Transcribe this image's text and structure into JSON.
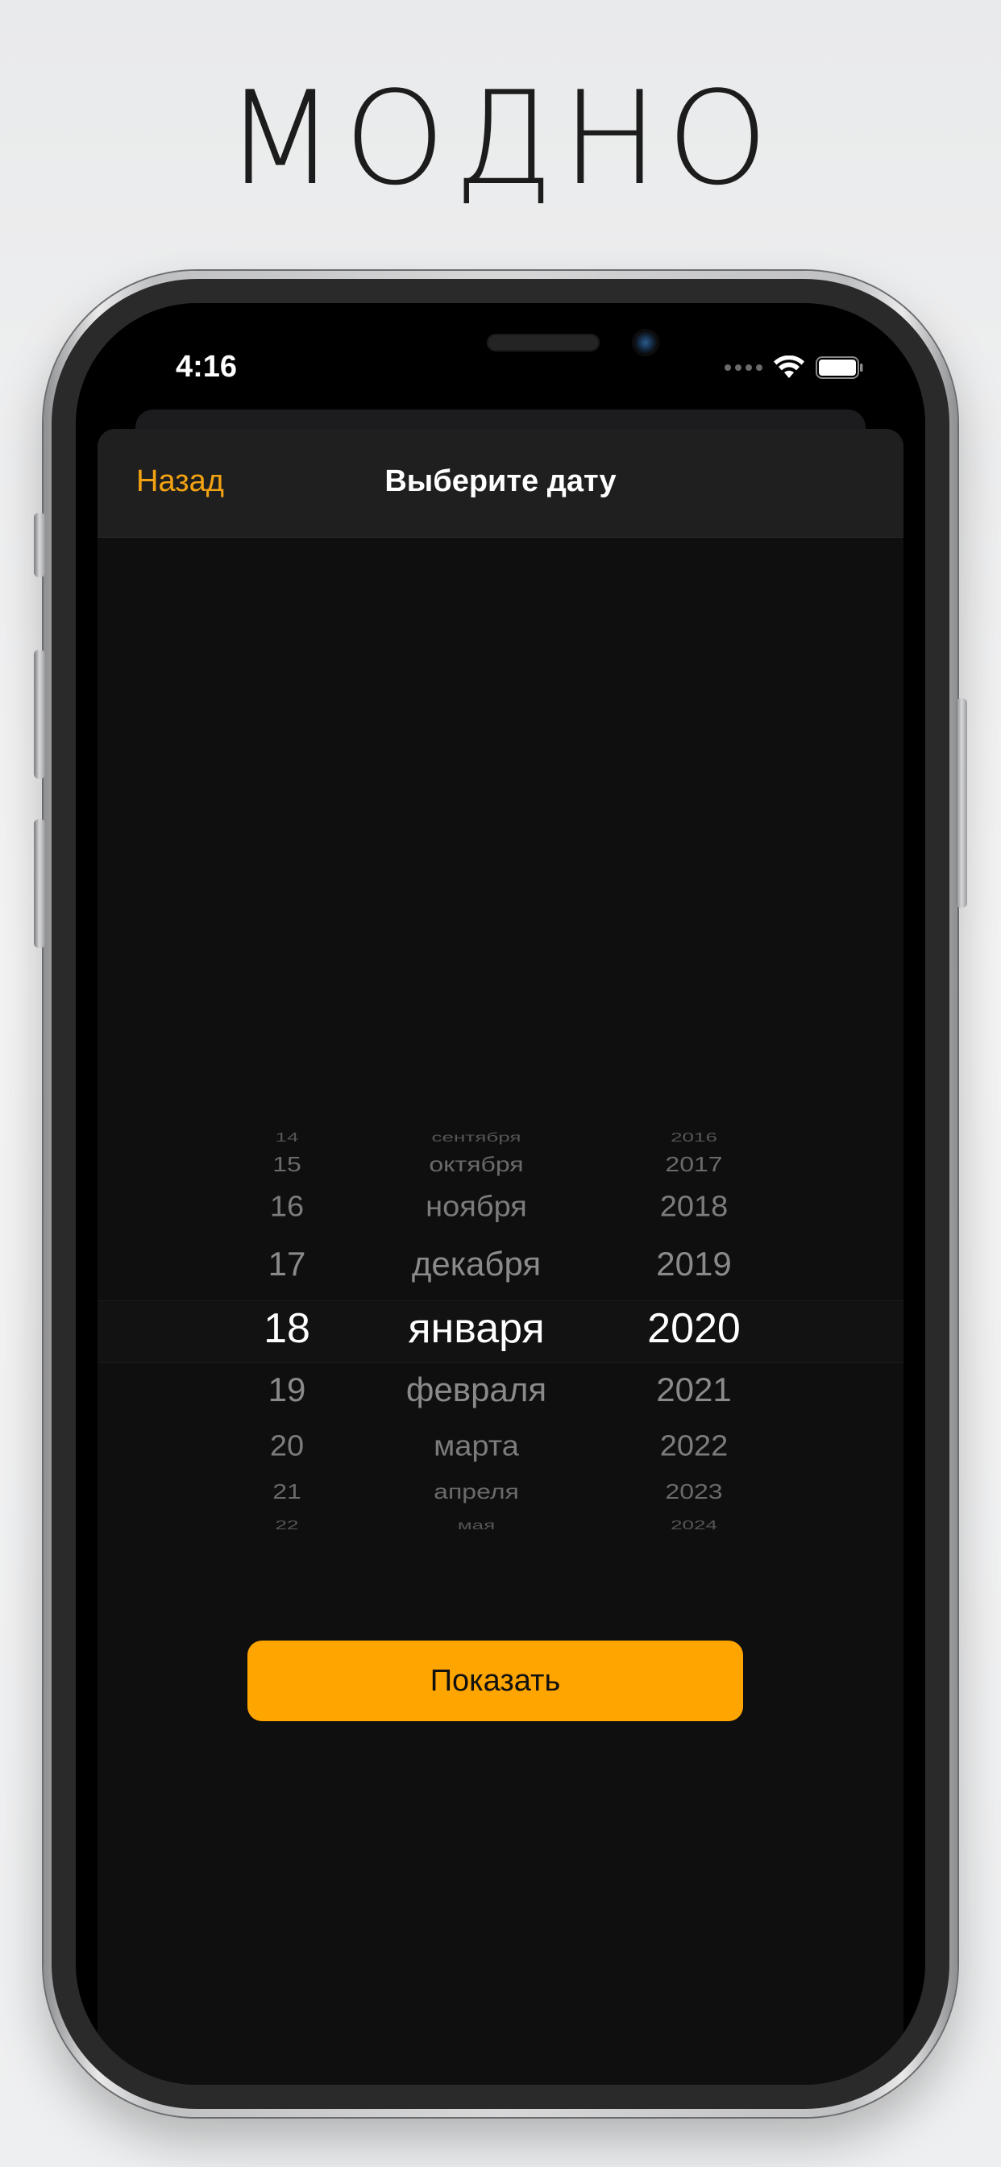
{
  "headline": "МОДНО",
  "status_bar": {
    "time": "4:16"
  },
  "navbar": {
    "back_label": "Назад",
    "title": "Выберите дату"
  },
  "picker": {
    "days": [
      "",
      "14",
      "15",
      "16",
      "17",
      "18",
      "19",
      "20",
      "21",
      "22",
      ""
    ],
    "months": [
      "",
      "сентября",
      "октября",
      "ноября",
      "декабря",
      "января",
      "февраля",
      "марта",
      "апреля",
      "мая",
      ""
    ],
    "years": [
      "",
      "2016",
      "2017",
      "2018",
      "2019",
      "2020",
      "2021",
      "2022",
      "2023",
      "2024",
      ""
    ],
    "selected": {
      "day": "18",
      "month": "января",
      "year": "2020"
    }
  },
  "show_button_label": "Показать",
  "colors": {
    "accent": "#FFA500",
    "back_text": "#F3A312",
    "background": "#0F0F0F"
  }
}
